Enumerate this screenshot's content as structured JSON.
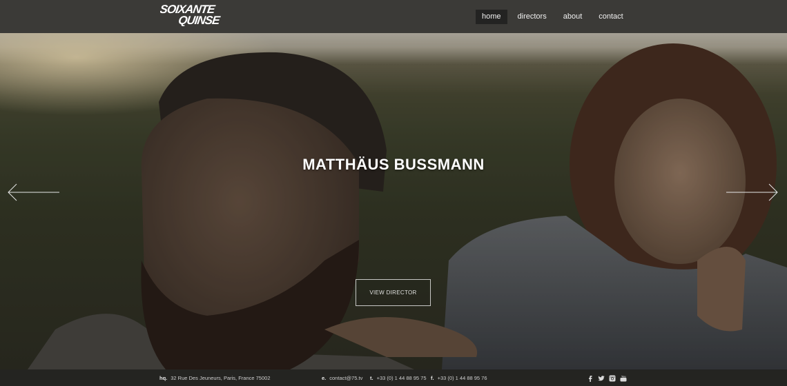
{
  "brand": {
    "logo_line1": "SOIXANTE",
    "logo_line2": "QUINSE"
  },
  "nav": {
    "items": [
      {
        "label": "home",
        "active": true
      },
      {
        "label": "directors",
        "active": false
      },
      {
        "label": "about",
        "active": false
      },
      {
        "label": "contact",
        "active": false
      }
    ]
  },
  "hero": {
    "title": "MATTHÄUS BUSSMANN",
    "button_label": "VIEW DIRECTOR",
    "prev_icon": "arrow-left-icon",
    "next_icon": "arrow-right-icon"
  },
  "footer": {
    "hq_key": "hq.",
    "hq_value": "32 Rue Des Jeuneurs, Paris, France 75002",
    "email_key": "e.",
    "email_value": "contact@75.tv",
    "tel_key": "t.",
    "tel_value": "+33 (0) 1 44 88 95 75",
    "fax_key": "f.",
    "fax_value": "+33 (0) 1 44 88 95 76",
    "social_icons": [
      "facebook-icon",
      "twitter-icon",
      "instagram-icon",
      "youtube-icon"
    ]
  },
  "colors": {
    "header_bg": "#3b3a37",
    "nav_active_bg": "#232322",
    "footer_bg": "#242421"
  }
}
